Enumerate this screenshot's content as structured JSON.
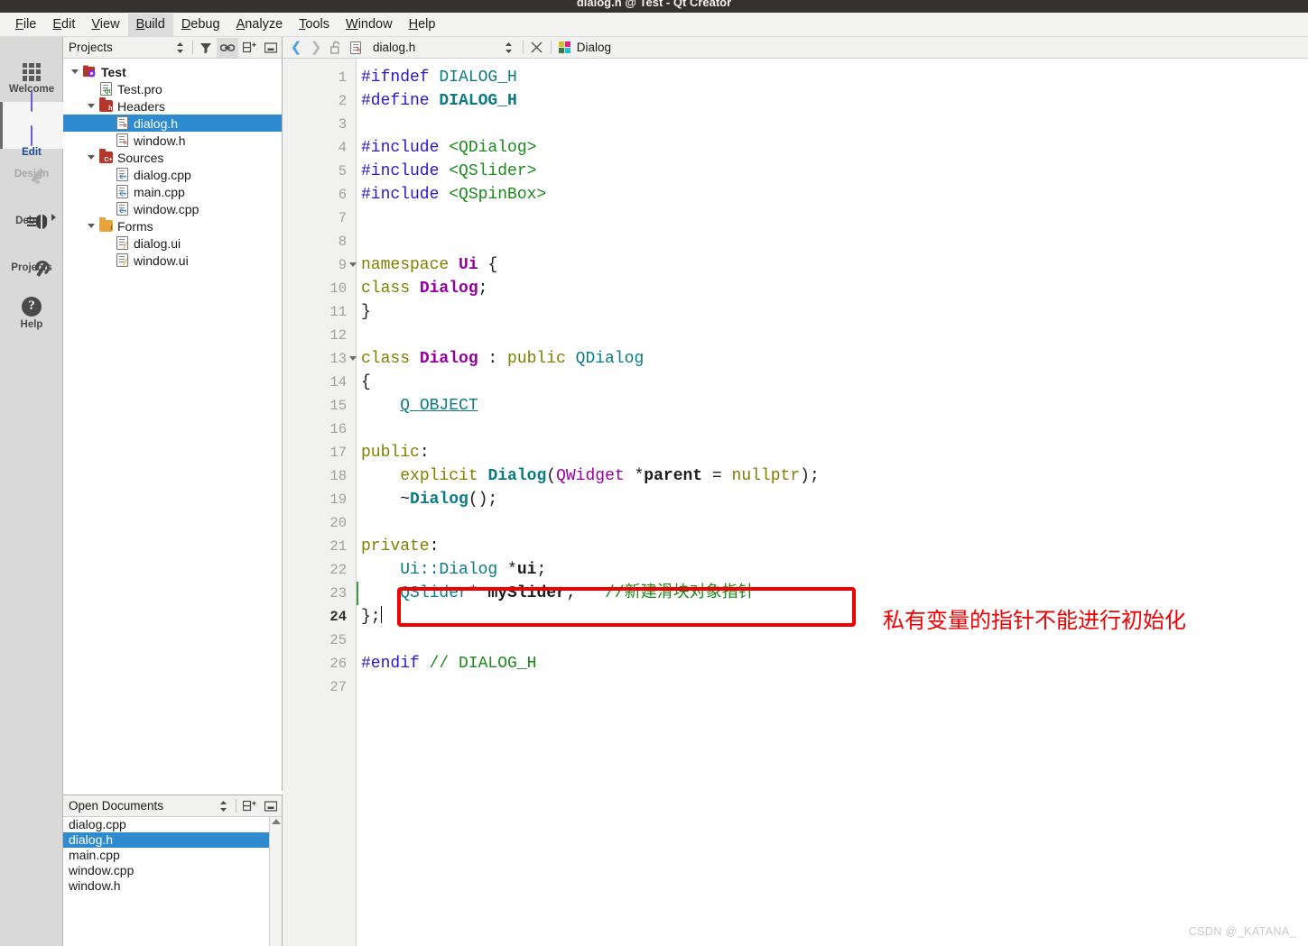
{
  "window": {
    "title": "dialog.h @ Test - Qt Creator"
  },
  "menubar": {
    "items": [
      {
        "label": "File",
        "mnemonic": "F",
        "active": false
      },
      {
        "label": "Edit",
        "mnemonic": "E",
        "active": false
      },
      {
        "label": "View",
        "mnemonic": "V",
        "active": false
      },
      {
        "label": "Build",
        "mnemonic": "B",
        "active": true
      },
      {
        "label": "Debug",
        "mnemonic": "D",
        "active": false
      },
      {
        "label": "Analyze",
        "mnemonic": "A",
        "active": false
      },
      {
        "label": "Tools",
        "mnemonic": "T",
        "active": false
      },
      {
        "label": "Window",
        "mnemonic": "W",
        "active": false
      },
      {
        "label": "Help",
        "mnemonic": "H",
        "active": false
      }
    ]
  },
  "modebar": {
    "items": [
      {
        "label": "Welcome",
        "icon": "grid-icon",
        "state": "normal"
      },
      {
        "label": "Edit",
        "icon": "edit-icon",
        "state": "selected"
      },
      {
        "label": "Design",
        "icon": "pencil-icon",
        "state": "disabled"
      },
      {
        "label": "Debug",
        "icon": "bug-icon",
        "state": "normal"
      },
      {
        "label": "Projects",
        "icon": "wrench-icon",
        "state": "normal"
      },
      {
        "label": "Help",
        "icon": "help-icon",
        "state": "normal"
      }
    ]
  },
  "projects_panel": {
    "title": "Projects",
    "toolbar": [
      "sort-selector-icon",
      "filter-icon",
      "sync-link-icon",
      "split-add-icon",
      "close-panel-icon"
    ],
    "tree": [
      {
        "label": "Test",
        "depth": 0,
        "icon": "qt-project-icon",
        "arrow": true,
        "bold": true,
        "selected": false
      },
      {
        "label": "Test.pro",
        "depth": 1,
        "icon": "pro-file-icon",
        "arrow": false,
        "bold": false,
        "selected": false
      },
      {
        "label": "Headers",
        "depth": 1,
        "icon": "headers-folder-icon",
        "arrow": true,
        "bold": false,
        "selected": false
      },
      {
        "label": "dialog.h",
        "depth": 2,
        "icon": "header-file-icon",
        "arrow": false,
        "bold": false,
        "selected": true
      },
      {
        "label": "window.h",
        "depth": 2,
        "icon": "header-file-icon",
        "arrow": false,
        "bold": false,
        "selected": false
      },
      {
        "label": "Sources",
        "depth": 1,
        "icon": "sources-folder-icon",
        "arrow": true,
        "bold": false,
        "selected": false
      },
      {
        "label": "dialog.cpp",
        "depth": 2,
        "icon": "cpp-file-icon",
        "arrow": false,
        "bold": false,
        "selected": false
      },
      {
        "label": "main.cpp",
        "depth": 2,
        "icon": "cpp-file-icon",
        "arrow": false,
        "bold": false,
        "selected": false
      },
      {
        "label": "window.cpp",
        "depth": 2,
        "icon": "cpp-file-icon",
        "arrow": false,
        "bold": false,
        "selected": false
      },
      {
        "label": "Forms",
        "depth": 1,
        "icon": "forms-folder-icon",
        "arrow": true,
        "bold": false,
        "selected": false
      },
      {
        "label": "dialog.ui",
        "depth": 2,
        "icon": "ui-file-icon",
        "arrow": false,
        "bold": false,
        "selected": false
      },
      {
        "label": "window.ui",
        "depth": 2,
        "icon": "ui-file-icon",
        "arrow": false,
        "bold": false,
        "selected": false
      }
    ]
  },
  "open_documents_panel": {
    "title": "Open Documents",
    "toolbar": [
      "sort-selector-icon",
      "split-add-icon",
      "close-panel-icon"
    ],
    "documents": [
      {
        "label": "dialog.cpp",
        "selected": false
      },
      {
        "label": "dialog.h",
        "selected": true
      },
      {
        "label": "main.cpp",
        "selected": false
      },
      {
        "label": "window.cpp",
        "selected": false
      },
      {
        "label": "window.h",
        "selected": false
      }
    ]
  },
  "editor": {
    "toolbar": {
      "back_icon": "chevron-left-icon",
      "forward_icon": "chevron-right-icon",
      "lock_icon": "unlock-icon",
      "file_icon": "header-file-icon",
      "filename": "dialog.h",
      "split_icon": "updown-selector-icon",
      "close_icon": "close-icon",
      "symbol_icon": "qt-class-icon",
      "symbol": "Dialog"
    },
    "current_line": 24,
    "changed_lines": [
      23
    ],
    "fold_lines": [
      9,
      13
    ],
    "lines": [
      {
        "n": 1,
        "tokens": [
          {
            "t": "#ifndef ",
            "c": "pp"
          },
          {
            "t": "DIALOG_H",
            "c": "type"
          }
        ]
      },
      {
        "n": 2,
        "tokens": [
          {
            "t": "#define ",
            "c": "pp"
          },
          {
            "t": "DIALOG_H",
            "c": "type-b"
          }
        ]
      },
      {
        "n": 3,
        "tokens": []
      },
      {
        "n": 4,
        "tokens": [
          {
            "t": "#include ",
            "c": "pp"
          },
          {
            "t": "<QDialog>",
            "c": "str"
          }
        ]
      },
      {
        "n": 5,
        "tokens": [
          {
            "t": "#include ",
            "c": "pp"
          },
          {
            "t": "<QSlider>",
            "c": "str"
          }
        ]
      },
      {
        "n": 6,
        "tokens": [
          {
            "t": "#include ",
            "c": "pp"
          },
          {
            "t": "<QSpinBox>",
            "c": "str"
          }
        ]
      },
      {
        "n": 7,
        "tokens": []
      },
      {
        "n": 8,
        "tokens": []
      },
      {
        "n": 9,
        "tokens": [
          {
            "t": "namespace ",
            "c": "kw"
          },
          {
            "t": "Ui",
            "c": "cls"
          },
          {
            "t": " {",
            "c": "plain"
          }
        ]
      },
      {
        "n": 10,
        "tokens": [
          {
            "t": "class ",
            "c": "kw"
          },
          {
            "t": "Dialog",
            "c": "cls"
          },
          {
            "t": ";",
            "c": "plain"
          }
        ]
      },
      {
        "n": 11,
        "tokens": [
          {
            "t": "}",
            "c": "plain"
          }
        ]
      },
      {
        "n": 12,
        "tokens": []
      },
      {
        "n": 13,
        "tokens": [
          {
            "t": "class ",
            "c": "kw"
          },
          {
            "t": "Dialog",
            "c": "cls"
          },
          {
            "t": " : ",
            "c": "plain"
          },
          {
            "t": "public ",
            "c": "kw"
          },
          {
            "t": "QDialog",
            "c": "type"
          }
        ]
      },
      {
        "n": 14,
        "tokens": [
          {
            "t": "{",
            "c": "plain"
          }
        ]
      },
      {
        "n": 15,
        "tokens": [
          {
            "t": "    ",
            "c": "plain"
          },
          {
            "t": "Q_OBJECT",
            "c": "macro"
          }
        ]
      },
      {
        "n": 16,
        "tokens": []
      },
      {
        "n": 17,
        "tokens": [
          {
            "t": "public",
            "c": "kw"
          },
          {
            "t": ":",
            "c": "plain"
          }
        ]
      },
      {
        "n": 18,
        "tokens": [
          {
            "t": "    ",
            "c": "plain"
          },
          {
            "t": "explicit ",
            "c": "kw"
          },
          {
            "t": "Dialog",
            "c": "type-b"
          },
          {
            "t": "(",
            "c": "plain"
          },
          {
            "t": "QWidget",
            "c": "qt"
          },
          {
            "t": " *",
            "c": "plain"
          },
          {
            "t": "parent",
            "c": "var"
          },
          {
            "t": " = ",
            "c": "plain"
          },
          {
            "t": "nullptr",
            "c": "kw"
          },
          {
            "t": ");",
            "c": "plain"
          }
        ]
      },
      {
        "n": 19,
        "tokens": [
          {
            "t": "    ~",
            "c": "plain"
          },
          {
            "t": "Dialog",
            "c": "type-b"
          },
          {
            "t": "();",
            "c": "plain"
          }
        ]
      },
      {
        "n": 20,
        "tokens": []
      },
      {
        "n": 21,
        "tokens": [
          {
            "t": "private",
            "c": "kw"
          },
          {
            "t": ":",
            "c": "plain"
          }
        ]
      },
      {
        "n": 22,
        "tokens": [
          {
            "t": "    ",
            "c": "plain"
          },
          {
            "t": "Ui::Dialog",
            "c": "type"
          },
          {
            "t": " *",
            "c": "plain"
          },
          {
            "t": "ui",
            "c": "var"
          },
          {
            "t": ";",
            "c": "plain"
          }
        ]
      },
      {
        "n": 23,
        "tokens": [
          {
            "t": "    ",
            "c": "plain"
          },
          {
            "t": "QSlider",
            "c": "type"
          },
          {
            "t": "* ",
            "c": "plain"
          },
          {
            "t": "mySlider",
            "c": "var"
          },
          {
            "t": ";   ",
            "c": "plain"
          },
          {
            "t": "//新建滑块对象指针",
            "c": "cmt"
          }
        ]
      },
      {
        "n": 24,
        "tokens": [
          {
            "t": "};",
            "c": "plain"
          }
        ]
      },
      {
        "n": 25,
        "tokens": []
      },
      {
        "n": 26,
        "tokens": [
          {
            "t": "#endif ",
            "c": "pp"
          },
          {
            "t": "// DIALOG_H",
            "c": "cmt"
          }
        ]
      },
      {
        "n": 27,
        "tokens": []
      }
    ]
  },
  "annotations": {
    "red_box_target_line": 23,
    "red_note": "私有变量的指针不能进行初始化",
    "red_color": "#ee0000"
  },
  "watermark": "CSDN @_KATANA_"
}
